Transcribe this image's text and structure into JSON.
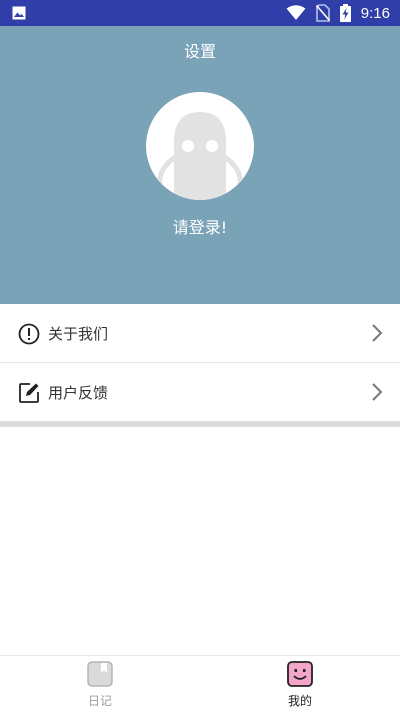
{
  "status_bar": {
    "time": "9:16",
    "icons": [
      "gallery-icon",
      "wifi-icon",
      "no-sim-icon",
      "battery-charging-icon"
    ]
  },
  "header": {
    "title": "设置",
    "login_text": "请登录!",
    "background": "#7aa3b8"
  },
  "menu": {
    "items": [
      {
        "label": "关于我们",
        "icon": "info-icon"
      },
      {
        "label": "用户反馈",
        "icon": "edit-icon"
      }
    ]
  },
  "bottom_nav": {
    "tabs": [
      {
        "label": "日记",
        "icon": "diary-icon",
        "active": false
      },
      {
        "label": "我的",
        "icon": "smiley-icon",
        "active": true
      }
    ]
  },
  "colors": {
    "status_bar": "#2f3ea8",
    "header": "#7aa3b8",
    "accent_pink": "#f4a6c8"
  }
}
